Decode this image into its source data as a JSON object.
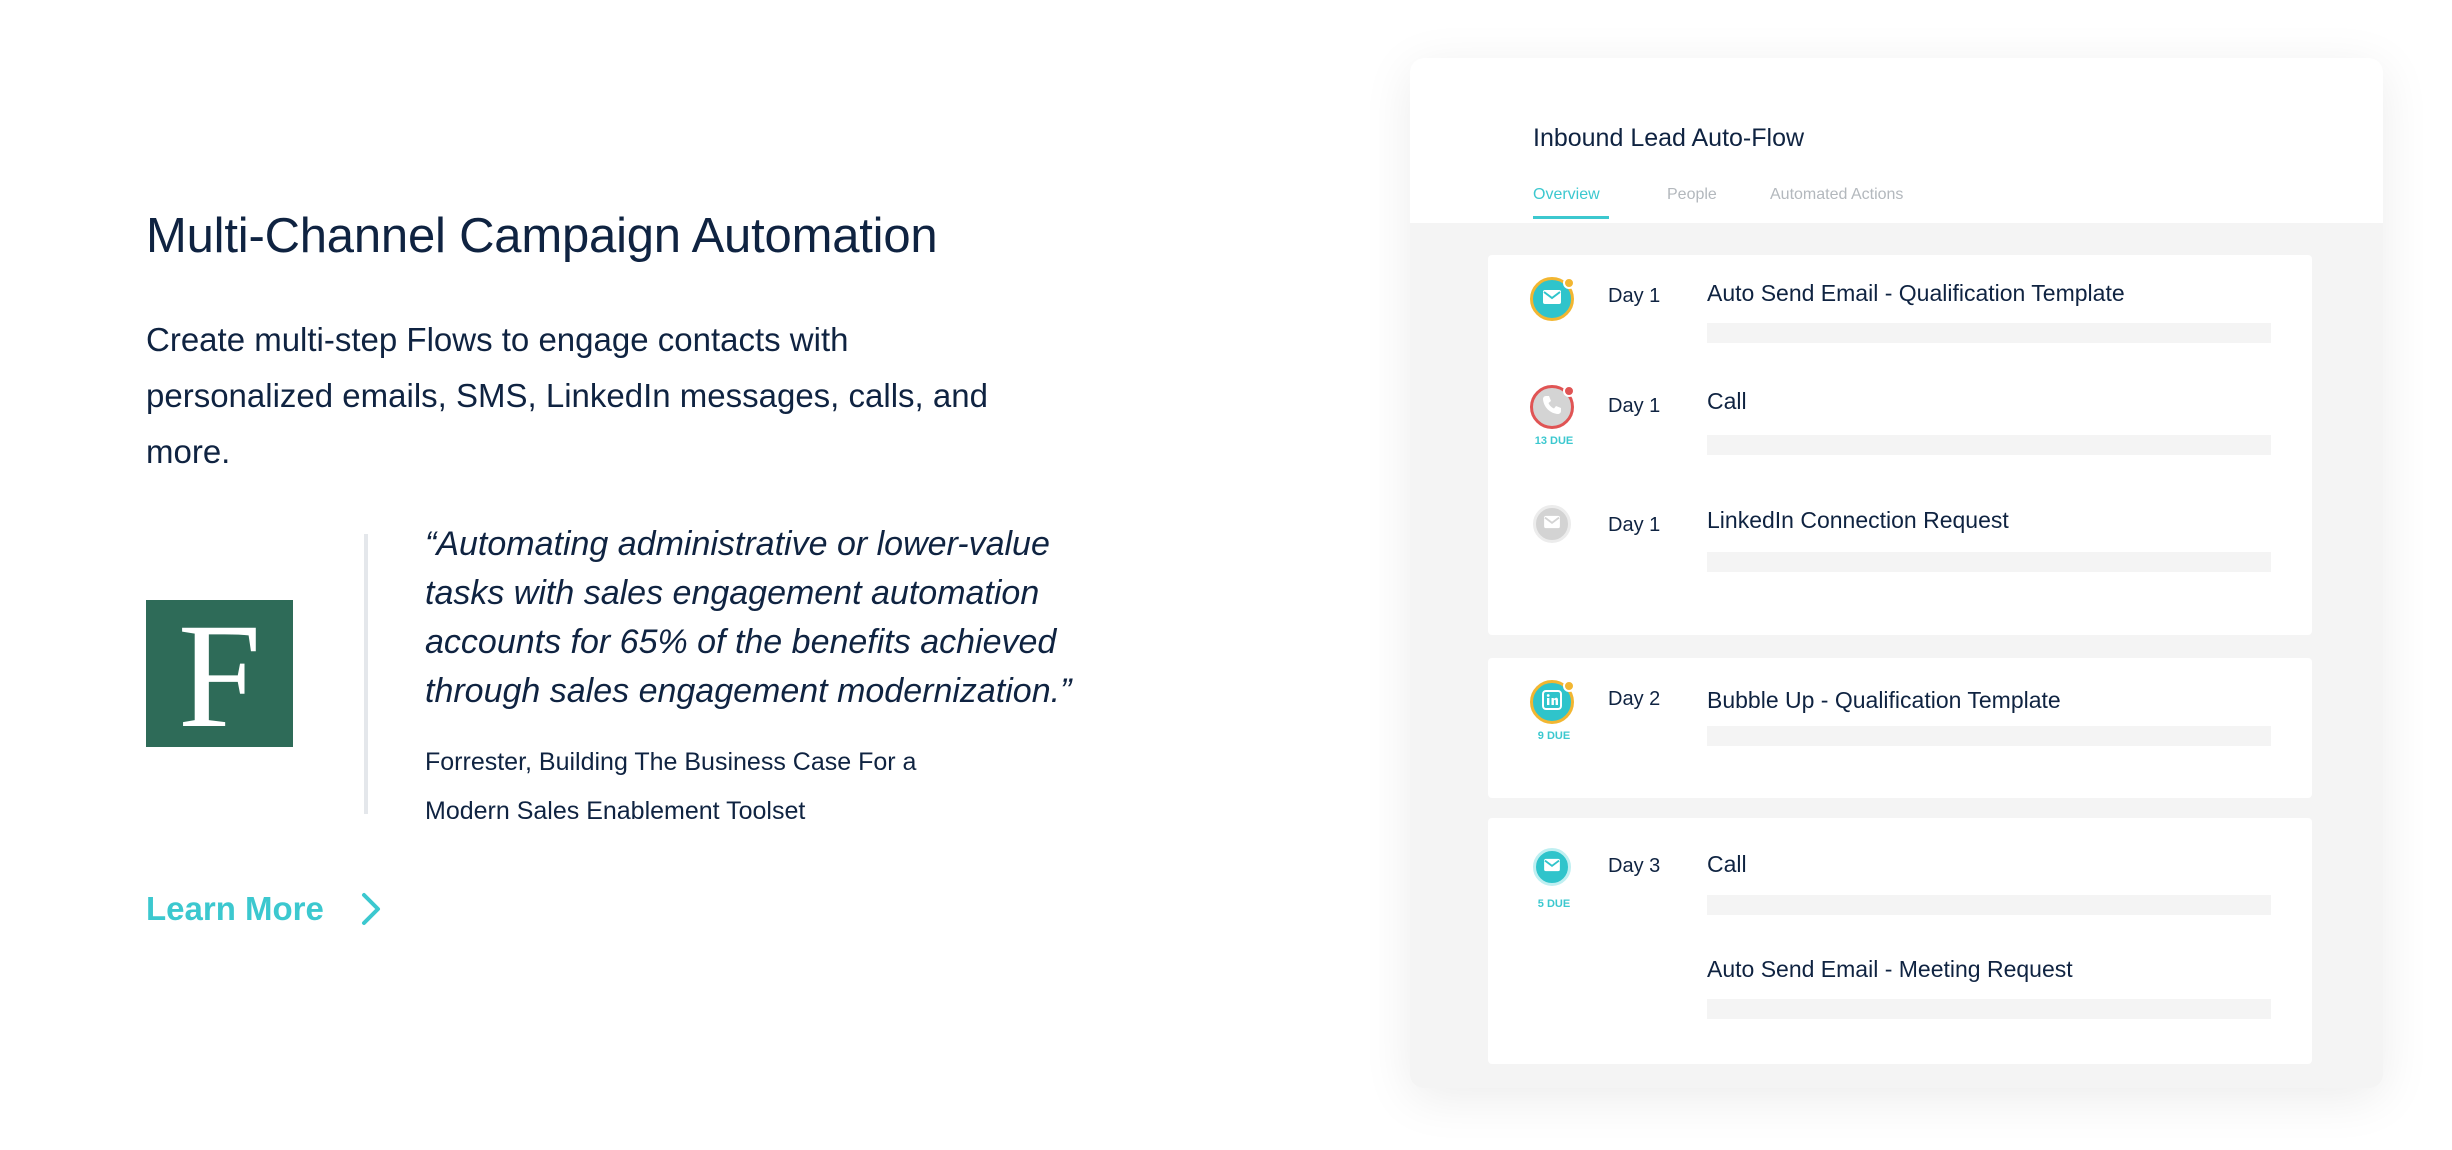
{
  "marketing": {
    "heading": "Multi-Channel Campaign Automation",
    "description": "Create multi-step Flows to engage contacts with personalized emails, SMS, LinkedIn messages, calls, and more.",
    "logo_letter": "F",
    "quote": "“Automating administrative or lower-value tasks with sales engagement automation accounts for 65% of the benefits achieved through sales engagement modernization.”",
    "source": "Forrester, Building The Business Case For a Modern Sales Enablement Toolset",
    "learn_more": "Learn More"
  },
  "app": {
    "title": "Inbound Lead Auto-Flow",
    "tabs": [
      {
        "label": "Overview",
        "active": true
      },
      {
        "label": "People",
        "active": false
      },
      {
        "label": "Automated Actions",
        "active": false
      }
    ],
    "steps": [
      {
        "day": "Day 1",
        "action": "Auto Send Email - Qualification Template",
        "icon": "email-icon",
        "badge": ""
      },
      {
        "day": "Day 1",
        "action": "Call",
        "icon": "phone-icon",
        "badge": "13 DUE"
      },
      {
        "day": "Day 1",
        "action": "LinkedIn Connection Request",
        "icon": "email-icon",
        "badge": ""
      },
      {
        "day": "Day 2",
        "action": "Bubble Up - Qualification Template",
        "icon": "linkedin-icon",
        "badge": "9 DUE"
      },
      {
        "day": "Day 3",
        "action": "Call",
        "icon": "email-icon",
        "badge": "5 DUE"
      },
      {
        "day": "",
        "action": "Auto Send Email - Meeting Request",
        "icon": "",
        "badge": ""
      }
    ]
  },
  "colors": {
    "navy": "#0f2341",
    "teal": "#3cc8cf",
    "forrester_green": "#2e6b58",
    "warning_yellow": "#f2b631",
    "alert_red": "#e05454"
  }
}
